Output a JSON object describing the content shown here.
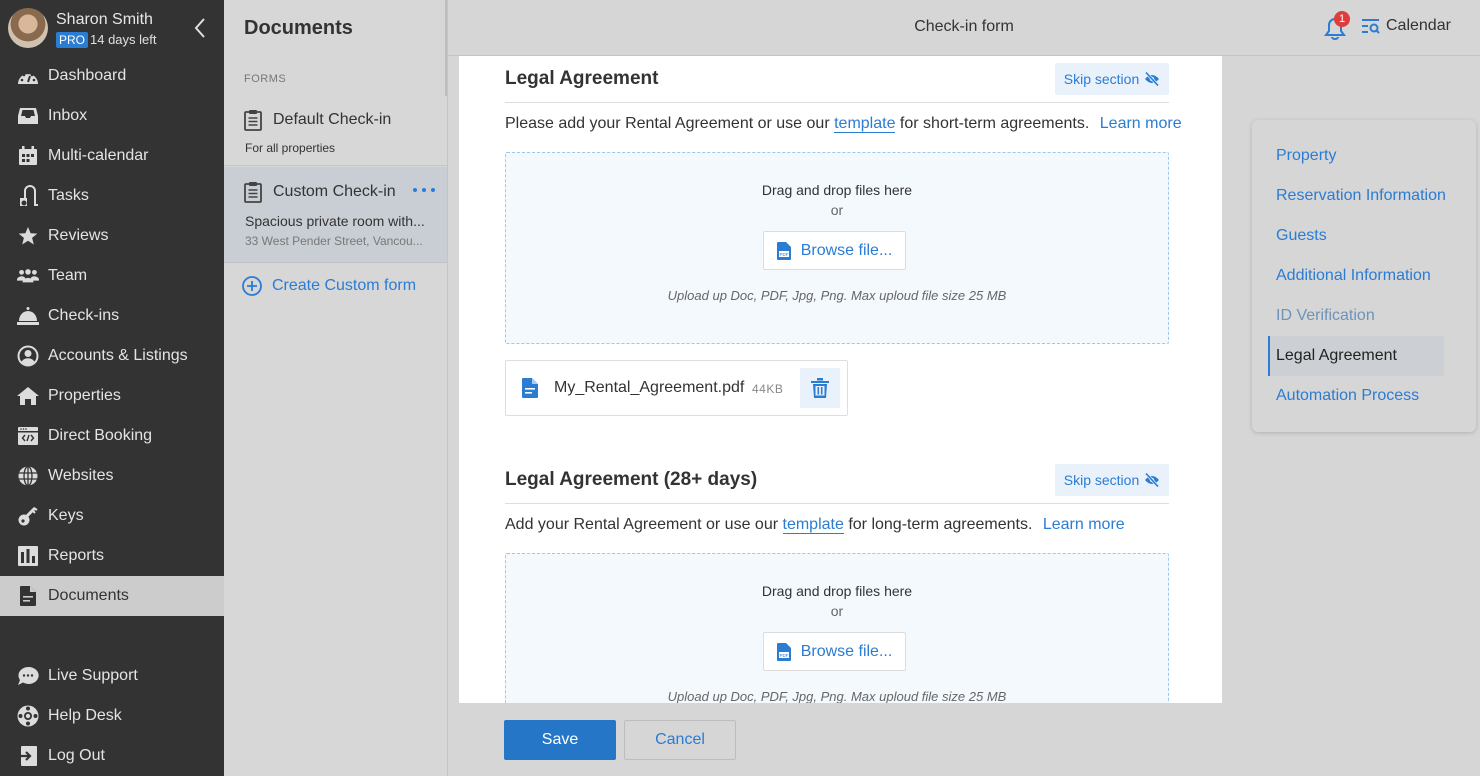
{
  "profile": {
    "name": "Sharon Smith",
    "plan_badge": "PRO",
    "trial_text": "14 days left"
  },
  "nav": {
    "items": [
      {
        "label": "Dashboard",
        "icon": "dashboard-icon"
      },
      {
        "label": "Inbox",
        "icon": "inbox-icon"
      },
      {
        "label": "Multi-calendar",
        "icon": "calendar-icon"
      },
      {
        "label": "Tasks",
        "icon": "vacuum-icon"
      },
      {
        "label": "Reviews",
        "icon": "star-icon"
      },
      {
        "label": "Team",
        "icon": "team-icon"
      },
      {
        "label": "Check-ins",
        "icon": "bell-desk-icon"
      },
      {
        "label": "Accounts & Listings",
        "icon": "user-circle-icon"
      },
      {
        "label": "Properties",
        "icon": "home-icon"
      },
      {
        "label": "Direct Booking",
        "icon": "code-window-icon"
      },
      {
        "label": "Websites",
        "icon": "globe-icon"
      },
      {
        "label": "Keys",
        "icon": "key-icon"
      },
      {
        "label": "Reports",
        "icon": "bar-chart-icon"
      },
      {
        "label": "Documents",
        "icon": "document-icon",
        "active": true
      }
    ],
    "bottom_items": [
      {
        "label": "Live Support",
        "icon": "chat-icon"
      },
      {
        "label": "Help Desk",
        "icon": "lifebuoy-icon"
      },
      {
        "label": "Log Out",
        "icon": "logout-icon"
      }
    ]
  },
  "documents": {
    "title": "Documents",
    "section_label": "FORMS",
    "forms": [
      {
        "name": "Default Check-in",
        "subtitle": "For all properties"
      },
      {
        "name": "Custom Check-in",
        "subtitle": "Spacious private room with...",
        "address": "33 West Pender Street, Vancou...",
        "selected": true
      }
    ],
    "create_label": "Create Custom form"
  },
  "topbar": {
    "title": "Check-in form",
    "notification_count": "1",
    "calendar_label": "Calendar"
  },
  "sections": [
    {
      "title": "Legal Agreement",
      "skip_label": "Skip section",
      "desc_before": "Please add your Rental Agreement or use our",
      "template_link": "template",
      "desc_after": "for short-term agreements.",
      "learn_more": "Learn more",
      "dropzone": {
        "drag_text": "Drag and drop files here",
        "or_text": "or",
        "browse_label": "Browse file...",
        "hint": "Upload up  Doc, PDF, Jpg, Png. Max uploud file size 25 MB"
      },
      "file": {
        "name": "My_Rental_Agreement.pdf",
        "size": "44KB"
      }
    },
    {
      "title": "Legal Agreement  (28+ days)",
      "skip_label": "Skip section",
      "desc_before": "Add your Rental Agreement or use our",
      "template_link": "template",
      "desc_after": "for long-term agreements.",
      "learn_more": "Learn more",
      "dropzone": {
        "drag_text": "Drag and drop files here",
        "or_text": "or",
        "browse_label": "Browse file...",
        "hint": "Upload up  Doc, PDF, Jpg, Png. Max uploud file size 25 MB"
      }
    }
  ],
  "section_nav": {
    "items": [
      {
        "label": "Property"
      },
      {
        "label": "Reservation Information"
      },
      {
        "label": "Guests"
      },
      {
        "label": "Additional Information"
      },
      {
        "label": "ID Verification",
        "state": "dim"
      },
      {
        "label": "Legal Agreement",
        "state": "active"
      },
      {
        "label": "Automation Process"
      }
    ]
  },
  "footer": {
    "save_label": "Save",
    "cancel_label": "Cancel"
  },
  "colors": {
    "accent": "#2b7cd3",
    "nav_bg": "#333333",
    "badge": "#e03c3c"
  }
}
